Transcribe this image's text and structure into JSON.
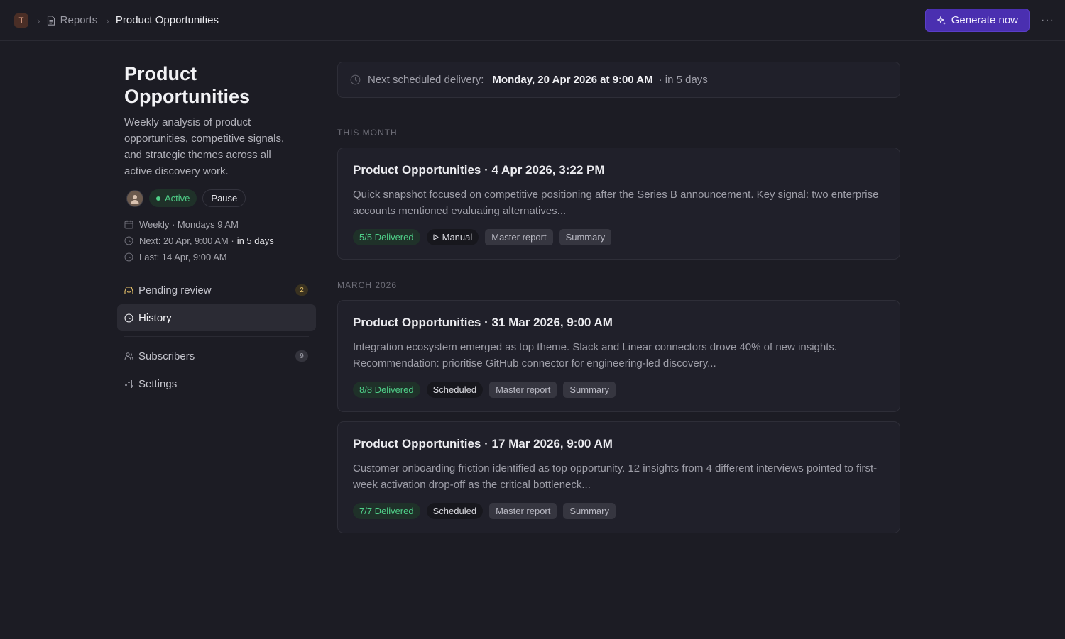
{
  "topbar": {
    "workspace_initial": "T",
    "breadcrumb": {
      "parent": "Reports",
      "current": "Product Opportunities"
    },
    "generate_label": "Generate now",
    "more_glyph": "···"
  },
  "report": {
    "title": "Product Opportunities",
    "description": "Weekly analysis of product opportunities, competitive signals, and strategic themes across all active discovery work.",
    "status": "Active",
    "pause_label": "Pause",
    "schedule": "Weekly · Mondays 9 AM",
    "next": {
      "text": "Next: 20 Apr, 9:00 AM ·",
      "relative": "in 5 days"
    },
    "last": "Last: 14 Apr, 9:00 AM"
  },
  "nav": {
    "pending": {
      "label": "Pending review",
      "count": "2"
    },
    "history": {
      "label": "History"
    },
    "subscribers": {
      "label": "Subscribers",
      "count": "9"
    },
    "settings": {
      "label": "Settings"
    }
  },
  "next_delivery": {
    "label": "Next scheduled delivery:",
    "when": "Monday, 20 Apr 2026 at 9:00 AM",
    "relative": "· in 5 days"
  },
  "sections": [
    {
      "label": "THIS MONTH",
      "reports": [
        {
          "title": "Product Opportunities · 4 Apr 2026, 3:22 PM",
          "summary": "Quick snapshot focused on competitive positioning after the Series B announcement. Key signal: two enterprise accounts mentioned evaluating alternatives...",
          "delivered": "5/5 Delivered",
          "trigger": "Manual",
          "tags": [
            "Master report",
            "Summary"
          ]
        }
      ]
    },
    {
      "label": "MARCH 2026",
      "reports": [
        {
          "title": "Product Opportunities · 31 Mar 2026, 9:00 AM",
          "summary": "Integration ecosystem emerged as top theme. Slack and Linear connectors drove 40% of new insights. Recommendation: prioritise GitHub connector for engineering-led discovery...",
          "delivered": "8/8 Delivered",
          "trigger": "Scheduled",
          "tags": [
            "Master report",
            "Summary"
          ]
        },
        {
          "title": "Product Opportunities · 17 Mar 2026, 9:00 AM",
          "summary": "Customer onboarding friction identified as top opportunity. 12 insights from 4 different interviews pointed to first-week activation drop-off as the critical bottleneck...",
          "delivered": "7/7 Delivered",
          "trigger": "Scheduled",
          "tags": [
            "Master report",
            "Summary"
          ]
        }
      ]
    }
  ],
  "colors": {
    "background": "#1c1c24",
    "accent": "#4a2fb0",
    "success": "#4fcf88",
    "warning": "#e8c26a"
  }
}
